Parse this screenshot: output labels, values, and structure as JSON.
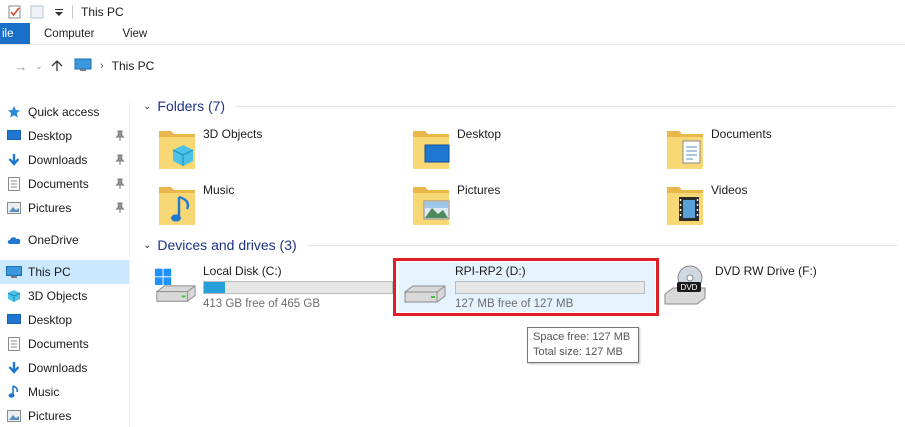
{
  "window": {
    "title": "This PC"
  },
  "ribbon": {
    "tabs": [
      "ile",
      "Computer",
      "View"
    ]
  },
  "address": {
    "location": "This PC"
  },
  "sidebar": {
    "quick_access": "Quick access",
    "quick_items": [
      {
        "label": "Desktop",
        "icon": "desktop-icon"
      },
      {
        "label": "Downloads",
        "icon": "downloads-icon"
      },
      {
        "label": "Documents",
        "icon": "documents-icon"
      },
      {
        "label": "Pictures",
        "icon": "pictures-icon"
      }
    ],
    "onedrive": "OneDrive",
    "this_pc": "This PC",
    "pc_items": [
      {
        "label": "3D Objects",
        "icon": "3d-objects-icon"
      },
      {
        "label": "Desktop",
        "icon": "desktop-icon"
      },
      {
        "label": "Documents",
        "icon": "documents-icon"
      },
      {
        "label": "Downloads",
        "icon": "downloads-icon"
      },
      {
        "label": "Music",
        "icon": "music-icon"
      },
      {
        "label": "Pictures",
        "icon": "pictures-icon"
      }
    ]
  },
  "folders": {
    "header": "Folders (7)",
    "items": [
      {
        "label": "3D Objects",
        "icon": "3d-objects-folder-icon"
      },
      {
        "label": "Desktop",
        "icon": "desktop-folder-icon"
      },
      {
        "label": "Documents",
        "icon": "documents-folder-icon"
      },
      {
        "label": "Music",
        "icon": "music-folder-icon"
      },
      {
        "label": "Pictures",
        "icon": "pictures-folder-icon"
      },
      {
        "label": "Videos",
        "icon": "videos-folder-icon"
      }
    ]
  },
  "drives": {
    "header": "Devices and drives (3)",
    "items": [
      {
        "label": "Local Disk (C:)",
        "free": "413 GB free of 465 GB",
        "used_fraction": 0.11,
        "icon": "windows-drive-icon"
      },
      {
        "label": "RPI-RP2 (D:)",
        "free": "127 MB free of 127 MB",
        "used_fraction": 0.0,
        "icon": "usb-drive-icon"
      },
      {
        "label": "DVD RW Drive (F:)",
        "icon": "dvd-drive-icon"
      }
    ]
  },
  "tooltip": {
    "line1": "Space free: 127 MB",
    "line2": "Total size: 127 MB"
  },
  "colors": {
    "accent": "#1a6fc9",
    "header_text": "#1e3287",
    "highlight": "#e01e26",
    "bar_fill": "#26a0da"
  }
}
